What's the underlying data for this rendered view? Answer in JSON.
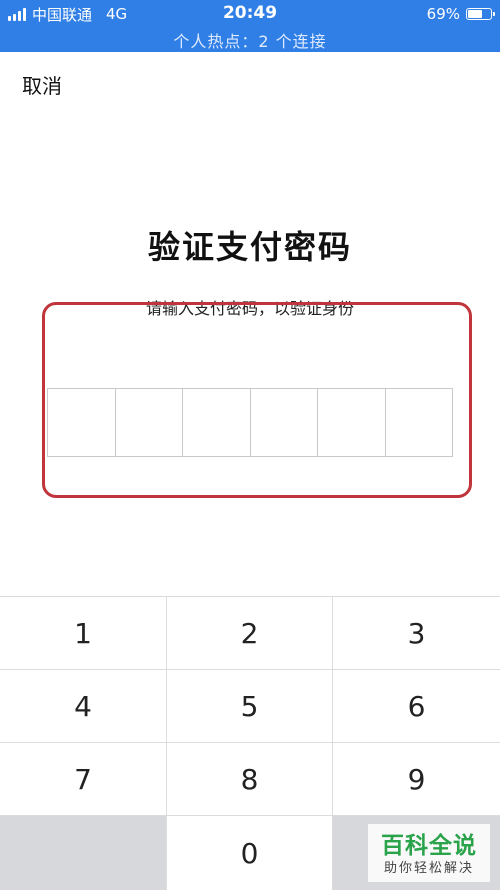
{
  "status_bar": {
    "carrier": "中国联通",
    "network": "4G",
    "time": "20:49",
    "battery": "69%",
    "battery_level": 0.69,
    "hotspot": "个人热点：2 个连接",
    "icons": {
      "signal": "signal-icon",
      "battery": "battery-icon"
    }
  },
  "header": {
    "cancel_label": "取消"
  },
  "main": {
    "title": "验证支付密码",
    "subtitle": "请输入支付密码，以验证身份",
    "pin_length": 6
  },
  "keypad": {
    "keys": [
      "1",
      "2",
      "3",
      "4",
      "5",
      "6",
      "7",
      "8",
      "9",
      "",
      "0",
      ""
    ]
  },
  "watermark": {
    "main": "百科全说",
    "sub": "助你轻松解决"
  },
  "colors": {
    "status_bar_bg": "#2f7fe6",
    "highlight_border": "#c0343c",
    "keypad_blank": "#d7d8dc",
    "watermark_green": "#2aa34a"
  }
}
